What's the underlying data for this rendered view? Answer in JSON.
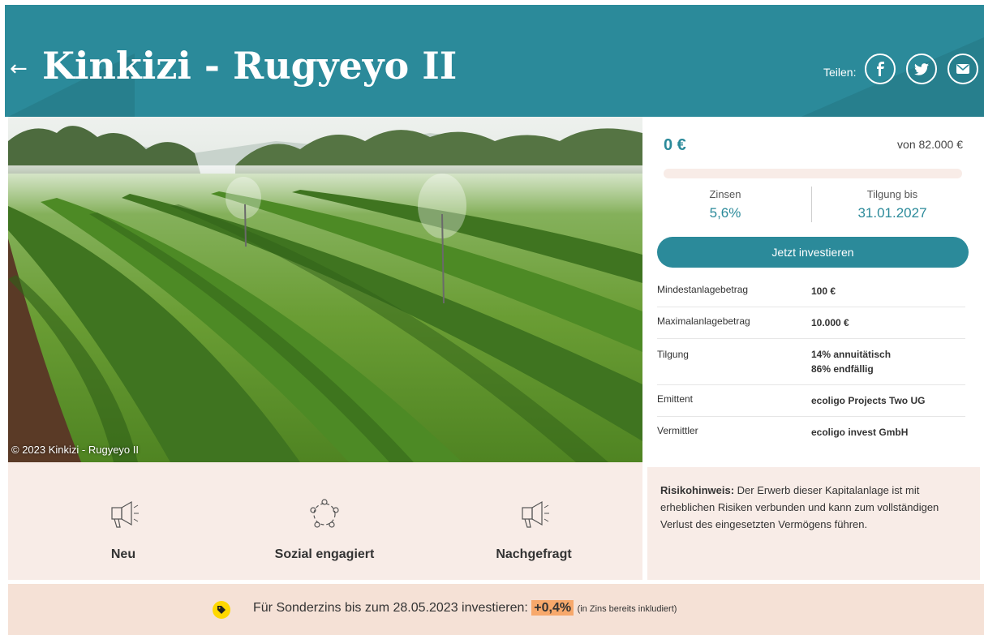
{
  "header": {
    "back_label": "←",
    "title": "Kinkizi - Rugyeyo II",
    "share_label": "Teilen:",
    "share_icons": [
      "facebook-icon",
      "twitter-icon",
      "email-icon"
    ],
    "bg_color": "#2b8a9a"
  },
  "photo": {
    "credit": "© 2023 Kinkizi - Rugyeyo II"
  },
  "funding": {
    "amount": "0 €",
    "of_total": "von 82.000 €",
    "progress": 0,
    "interest_label": "Zinsen",
    "interest_value": "5,6%",
    "repayment_label": "Tilgung bis",
    "repayment_value": "31.01.2027",
    "invest_button": "Jetzt investieren"
  },
  "details": [
    {
      "key": "Mindestanlagebetrag",
      "value": "100 €"
    },
    {
      "key": "Maximalanlagebetrag",
      "value": "10.000 €"
    },
    {
      "key": "Tilgung",
      "value": "14% annuitätisch",
      "value2": "86% endfällig"
    },
    {
      "key": "Emittent",
      "value": "ecoligo Projects Two UG"
    },
    {
      "key": "Vermittler",
      "value": "ecoligo invest GmbH"
    }
  ],
  "features": [
    {
      "label": "Neu",
      "icon": "megaphone-icon"
    },
    {
      "label": "Sozial engagiert",
      "icon": "community-icon"
    },
    {
      "label": "Nachgefragt",
      "icon": "megaphone-icon"
    }
  ],
  "risk": {
    "title": "Risikohinweis:",
    "text": " Der Erwerb dieser Kapitalanlage ist mit erheblichen Risiken verbunden und kann zum vollständigen Verlust des eingesetzten Vermögens führen."
  },
  "banner": {
    "text": "Für Sonderzins bis zum 28.05.2023 investieren: ",
    "bonus": "+0,4%",
    "note": "(in Zins bereits inkludiert)",
    "icon": "tag-icon"
  },
  "colors": {
    "accent": "#2b8a9a",
    "light_bg": "#f8ece7",
    "banner_bg": "#f5e1d6",
    "bonus_highlight": "#f7a86b",
    "tag_yellow": "#ffd800"
  }
}
